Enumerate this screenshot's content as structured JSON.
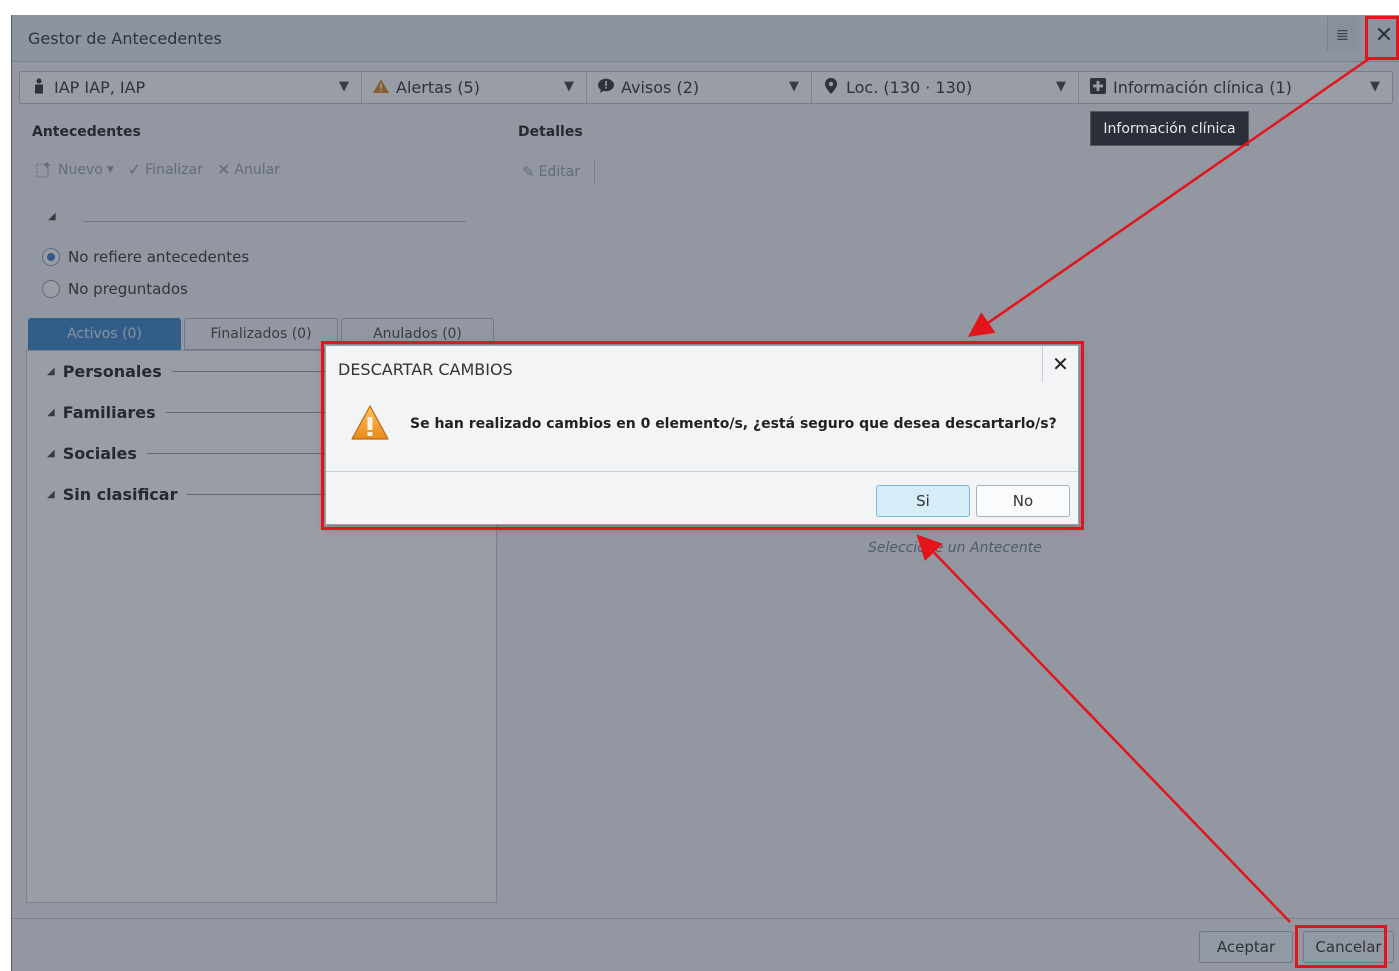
{
  "window": {
    "title": "Gestor de Antecedentes",
    "menu_icon": "menu-icon",
    "close_icon": "close-icon"
  },
  "infobar": [
    {
      "icon": "person-icon",
      "label": "IAP IAP, IAP"
    },
    {
      "icon": "warning-icon",
      "label": "Alertas  (5)"
    },
    {
      "icon": "speech-bubble-icon",
      "label": "Avisos  (2)"
    },
    {
      "icon": "location-pin-icon",
      "label": "Loc. (130 · 130)"
    },
    {
      "icon": "medical-plus-icon",
      "label": "Información clínica  (1)"
    }
  ],
  "left": {
    "title": "Antecedentes",
    "toolbar": {
      "new": "Nuevo",
      "finish": "Finalizar",
      "cancel": "Anular"
    },
    "radios": [
      {
        "label": "No refiere antecedentes",
        "checked": true
      },
      {
        "label": "No preguntados",
        "checked": false
      }
    ],
    "tabs": [
      "Activos (0)",
      "Finalizados (0)",
      "Anulados (0)"
    ],
    "groups": [
      "Personales",
      "Familiares",
      "Sociales",
      "Sin clasificar"
    ]
  },
  "details": {
    "title": "Detalles",
    "edit": "Editar",
    "empty": "Seleccione un Antecente"
  },
  "tooltip": "Información clínica",
  "footer": {
    "accept": "Aceptar",
    "cancel": "Cancelar"
  },
  "dialog": {
    "title": "DESCARTAR CAMBIOS",
    "message": "Se han realizado cambios en 0 elemento/s, ¿está seguro que desea descartarlo/s?",
    "yes": "Si",
    "no": "No"
  },
  "colors": {
    "annotation": "#e3141b",
    "tab_active": "#3b84c8",
    "warning": "#f0a030"
  }
}
